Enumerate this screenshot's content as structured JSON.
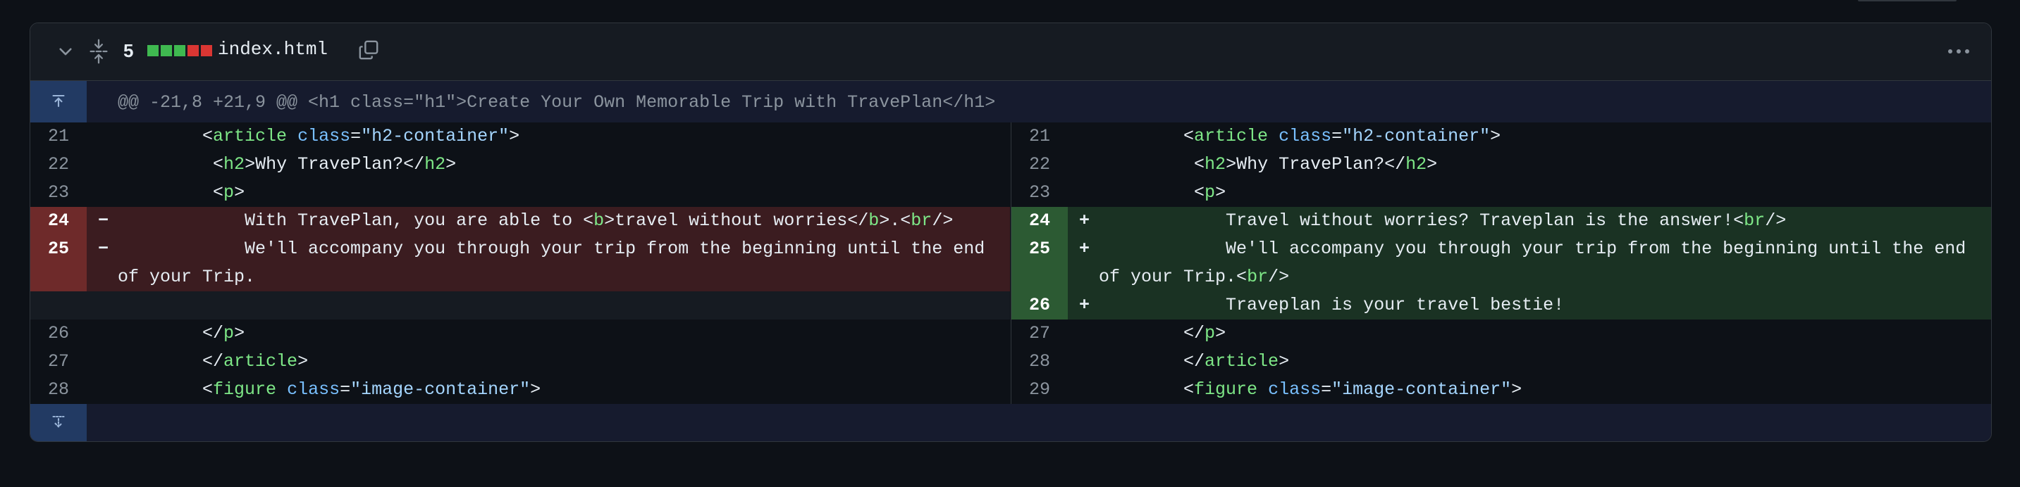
{
  "file": {
    "change_count": "5",
    "name": "index.html",
    "diff_blocks": [
      "add",
      "add",
      "add",
      "del",
      "del"
    ],
    "colors": {
      "add": "#3fb950",
      "del": "#da3633",
      "neutral": "#30363d"
    }
  },
  "hunk": {
    "header": "@@ -21,8 +21,9 @@ <h1 class=\"h1\">Create Your Own Memorable Trip with TravePlan</h1>"
  },
  "left": [
    {
      "num": "21",
      "kind": "ctx",
      "code": "        <article class=\"h2-container\">"
    },
    {
      "num": "22",
      "kind": "ctx",
      "code": "         <h2>Why TravePlan?</h2>"
    },
    {
      "num": "23",
      "kind": "ctx",
      "code": "         <p>"
    },
    {
      "num": "24",
      "kind": "del",
      "sign": "−",
      "code": "            With TravePlan, you are able to <b>travel without worries</b>.<br/>"
    },
    {
      "num": "25",
      "kind": "del",
      "sign": "−",
      "code": "            We'll accompany you through your trip from the beginning until the end of your Trip."
    },
    {
      "num": "",
      "kind": "empty",
      "code": ""
    },
    {
      "num": "26",
      "kind": "ctx",
      "code": "        </p>"
    },
    {
      "num": "27",
      "kind": "ctx",
      "code": "        </article>"
    },
    {
      "num": "28",
      "kind": "ctx",
      "code": "        <figure class=\"image-container\">"
    }
  ],
  "right": [
    {
      "num": "21",
      "kind": "ctx",
      "code": "        <article class=\"h2-container\">"
    },
    {
      "num": "22",
      "kind": "ctx",
      "code": "         <h2>Why TravePlan?</h2>"
    },
    {
      "num": "23",
      "kind": "ctx",
      "code": "         <p>"
    },
    {
      "num": "24",
      "kind": "add",
      "sign": "+",
      "code": "            Travel without worries? Traveplan is the answer!<br/>"
    },
    {
      "num": "25",
      "kind": "add",
      "sign": "+",
      "code": "            We'll accompany you through your trip from the beginning until the end of your Trip.<br/>"
    },
    {
      "num": "26",
      "kind": "add",
      "sign": "+",
      "code": "            Traveplan is your travel bestie!"
    },
    {
      "num": "27",
      "kind": "ctx",
      "code": "        </p>"
    },
    {
      "num": "28",
      "kind": "ctx",
      "code": "        </article>"
    },
    {
      "num": "29",
      "kind": "ctx",
      "code": "        <figure class=\"image-container\">"
    }
  ],
  "icons": {
    "collapse": "chevron-down-icon",
    "expand": "expand-all-icon",
    "copy": "copy-icon",
    "more": "kebab-horizontal-icon",
    "expand_up": "expand-up-icon",
    "expand_down": "expand-down-icon"
  }
}
